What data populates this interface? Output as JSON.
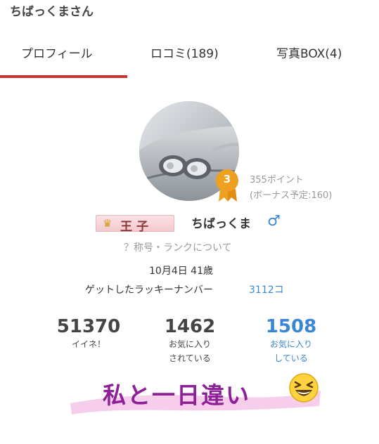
{
  "header": {
    "title": "ちばっくまさん"
  },
  "tabs": [
    {
      "label": "プロフィール",
      "active": true
    },
    {
      "label": "ロコミ(189)"
    },
    {
      "label": "写真BOX(4)"
    }
  ],
  "colors": {
    "accent": "#d0312d",
    "link": "#3a86d6",
    "caption": "#8d1f97",
    "badge": "#f0a020"
  },
  "profile": {
    "rank": "3",
    "points": "355ポイント",
    "bonus": "(ボーナス予定:160)",
    "title_badge": "王子",
    "username": "ちばっくま",
    "gender_icon": "♂",
    "rank_link": "？称号・ランクについて",
    "birthday": "10月4日 41歳",
    "lucky_label": "ゲットしたラッキーナンバー",
    "lucky_value": "3112コ"
  },
  "stats": [
    {
      "value": "51370",
      "label1": "イイネ！",
      "label2": ""
    },
    {
      "value": "1462",
      "label1": "お気に入り",
      "label2": "されている"
    },
    {
      "value": "1508",
      "label1": "お気に入り",
      "label2": "している"
    }
  ],
  "caption": {
    "text": "私と一日違い",
    "emoji": "grinning-squinting-face"
  }
}
